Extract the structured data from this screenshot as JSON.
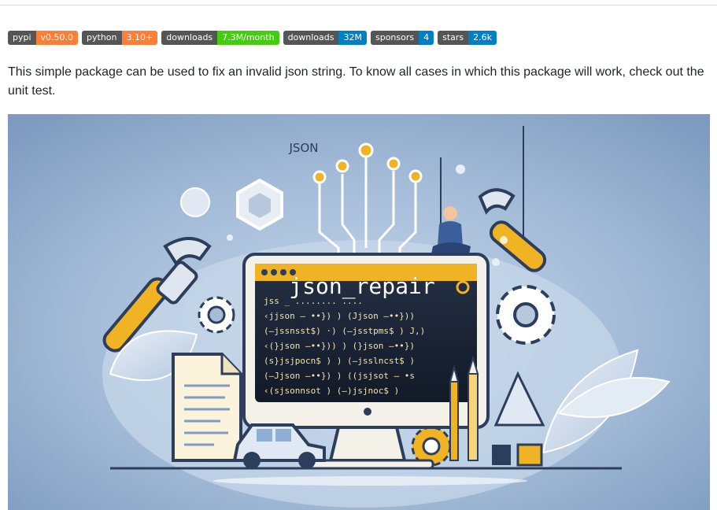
{
  "badges": [
    {
      "left": "pypi",
      "right": "v0.50.0",
      "color": "#fe7d37"
    },
    {
      "left": "python",
      "right": "3.10+",
      "color": "#fe7d37"
    },
    {
      "left": "downloads",
      "right": "7.3M/month",
      "color": "#4c1"
    },
    {
      "left": "downloads",
      "right": "32M",
      "color": "#007ec6"
    },
    {
      "left": "sponsors",
      "right": "4",
      "color": "#007ec6"
    },
    {
      "left": "stars",
      "right": "2.6k",
      "color": "#007ec6"
    }
  ],
  "description": "This simple package can be used to fix an invalid json string. To know all cases in which this package will work, check out the unit test.",
  "hero": {
    "top_label": "JSON",
    "screen_title": "json_repair",
    "code_lines": [
      "jss _ ........ ....",
      "‹jjson — ••}) ) (Jjson —••}))",
      "(—jssnsst$) ·) (—jsstpms$ ) J,)",
      "‹(}json —••})) ) (}json —••})",
      "(s}jsjpocn$ ) ) (—jsslncst$ )",
      "(—Jjson —••}) ) ((jsjsot — •s",
      "‹(sjsonnsot ) (—)jsjnoc$ )"
    ]
  }
}
